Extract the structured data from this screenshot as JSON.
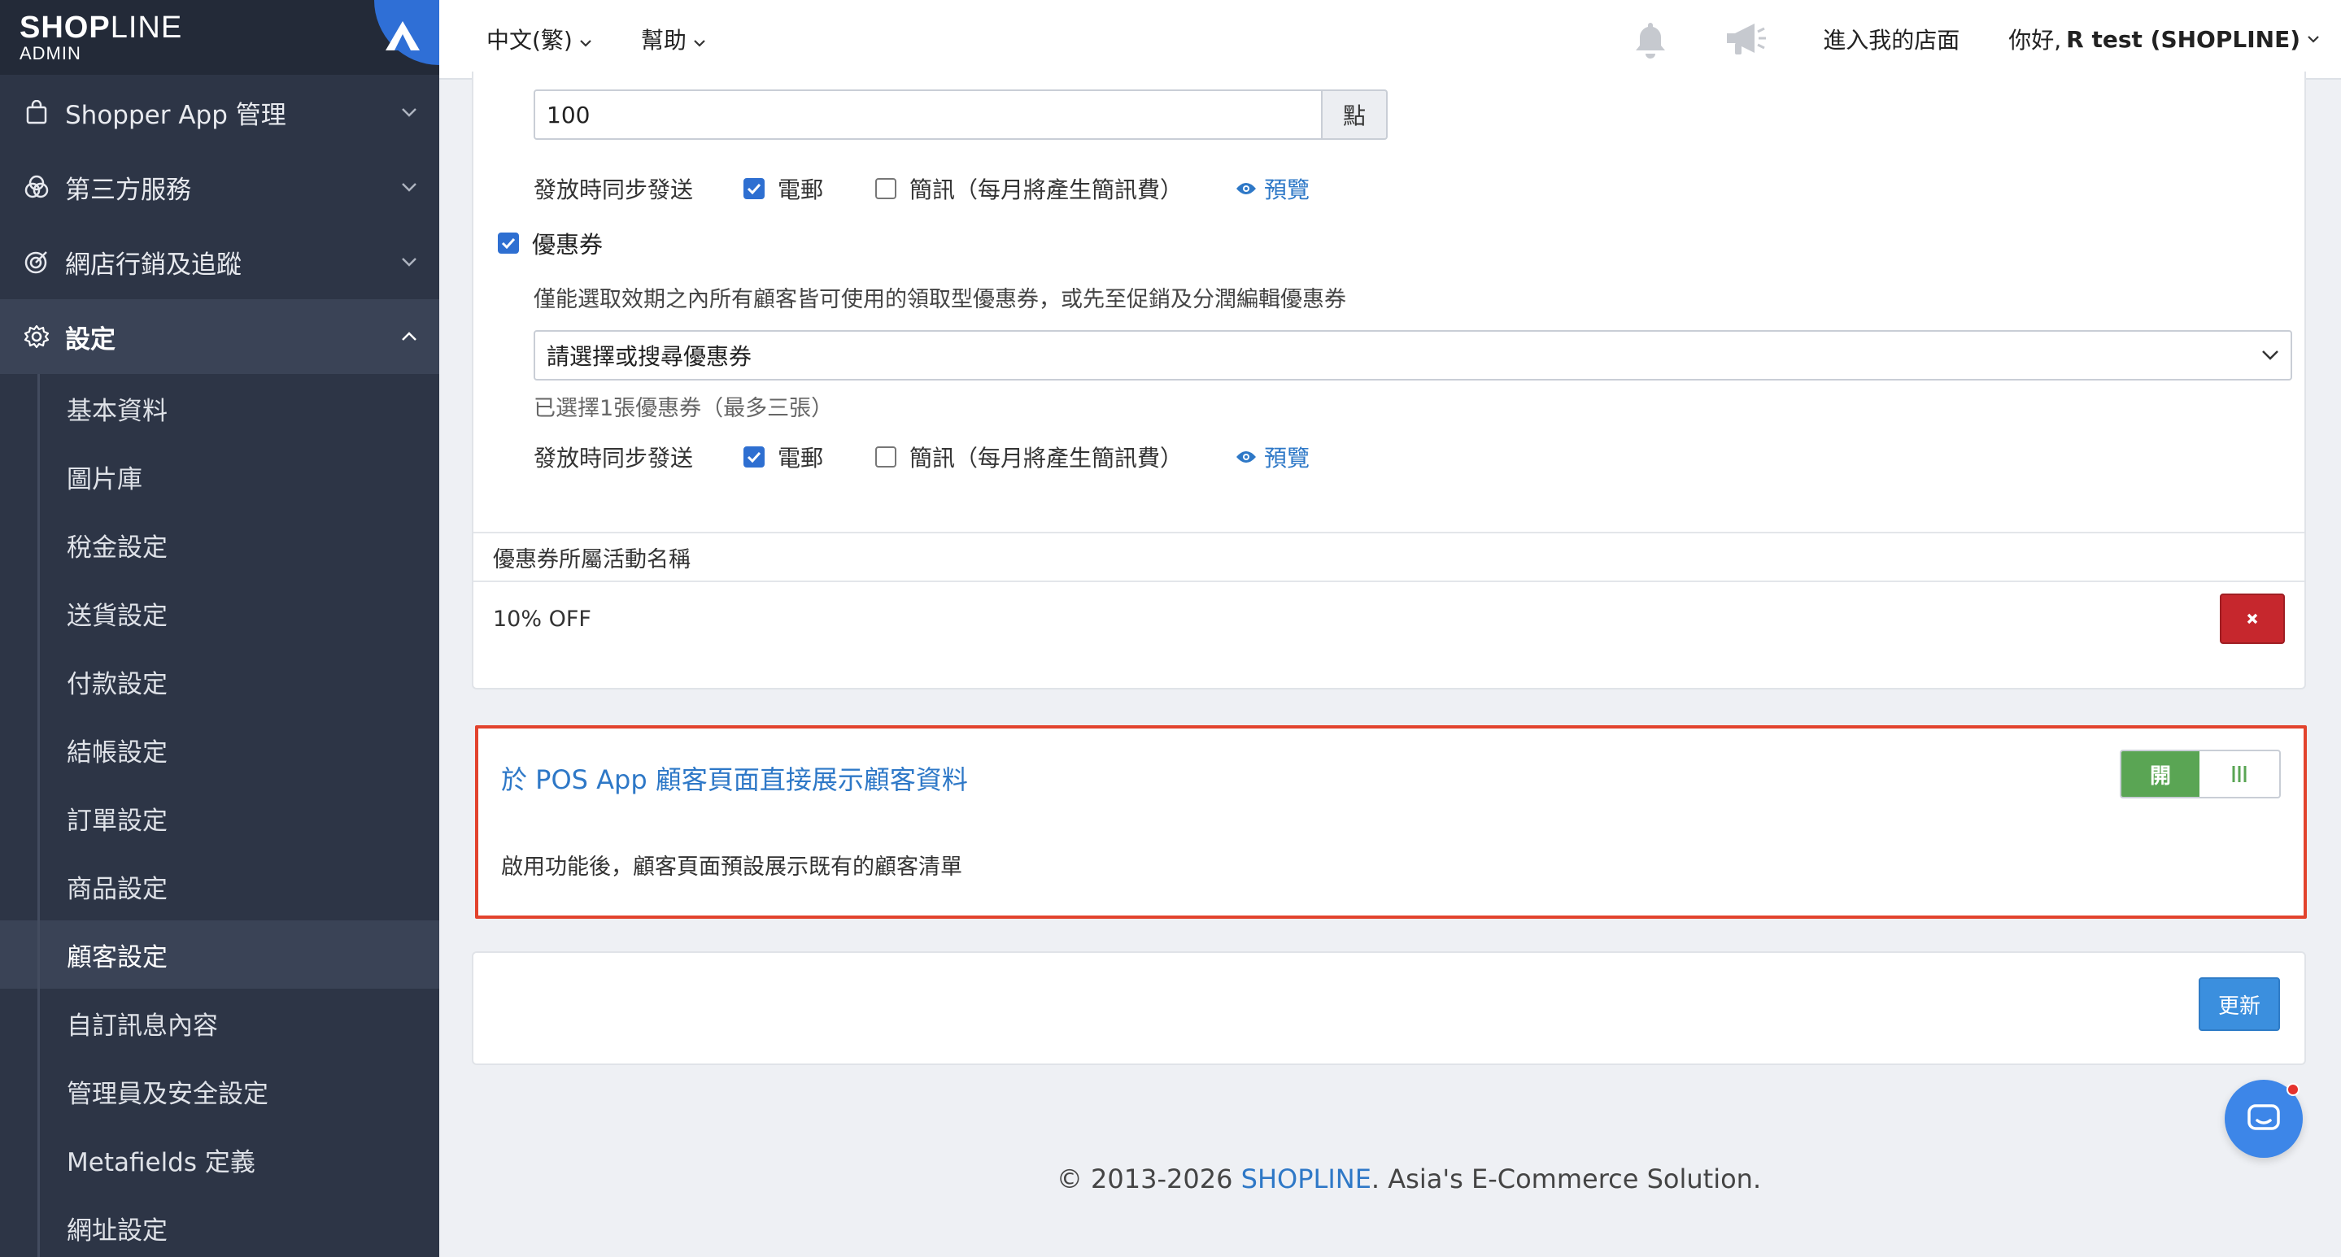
{
  "brand": {
    "name_bold": "SHOP",
    "name_thin": "LINE",
    "sub": "ADMIN"
  },
  "sidebar": {
    "groups": [
      {
        "label": "Shopper App 管理",
        "icon": "shopping-bag-icon"
      },
      {
        "label": "第三方服務",
        "icon": "circles-icon"
      },
      {
        "label": "網店行銷及追蹤",
        "icon": "target-icon"
      },
      {
        "label": "設定",
        "icon": "gear-icon"
      }
    ],
    "items": [
      {
        "label": "基本資料"
      },
      {
        "label": "圖片庫"
      },
      {
        "label": "稅金設定"
      },
      {
        "label": "送貨設定"
      },
      {
        "label": "付款設定"
      },
      {
        "label": "結帳設定"
      },
      {
        "label": "訂單設定"
      },
      {
        "label": "商品設定"
      },
      {
        "label": "顧客設定"
      },
      {
        "label": "自訂訊息內容"
      },
      {
        "label": "管理員及安全設定"
      },
      {
        "label": "Metafields 定義"
      },
      {
        "label": "網址設定"
      }
    ]
  },
  "topbar": {
    "language": "中文(繁)",
    "help": "幫助",
    "store_link": "進入我的店面",
    "greeting": "你好,",
    "user": "R test (SHOPLINE)"
  },
  "reward": {
    "points_value": "100",
    "points_unit": "點",
    "sync_label": "發放時同步發送",
    "email_label": "電郵",
    "sms_label": "簡訊（每月將產生簡訊費）",
    "preview_label": "預覽",
    "coupon_label": "優惠券",
    "coupon_note": "僅能選取效期之內所有顧客皆可使用的領取型優惠券，或先至促銷及分潤編輯優惠券",
    "coupon_placeholder": "請選擇或搜尋優惠券",
    "coupon_count": "已選擇1張優惠券（最多三張）",
    "table_header": "優惠券所屬活動名稱",
    "table_row": "10% OFF"
  },
  "pos": {
    "title": "於 POS App 顧客頁面直接展示顧客資料",
    "description": "啟用功能後，顧客頁面預設展示既有的顧客清單",
    "toggle_on": "開"
  },
  "actions": {
    "update": "更新"
  },
  "footer": {
    "prefix": "© 2013-2026 ",
    "brand": "SHOPLINE",
    "suffix": ". Asia's E-Commerce Solution."
  },
  "colors": {
    "accent": "#2e78c7",
    "highlight": "#e2432d",
    "toggle_on": "#5aa554",
    "danger": "#c6272d"
  }
}
